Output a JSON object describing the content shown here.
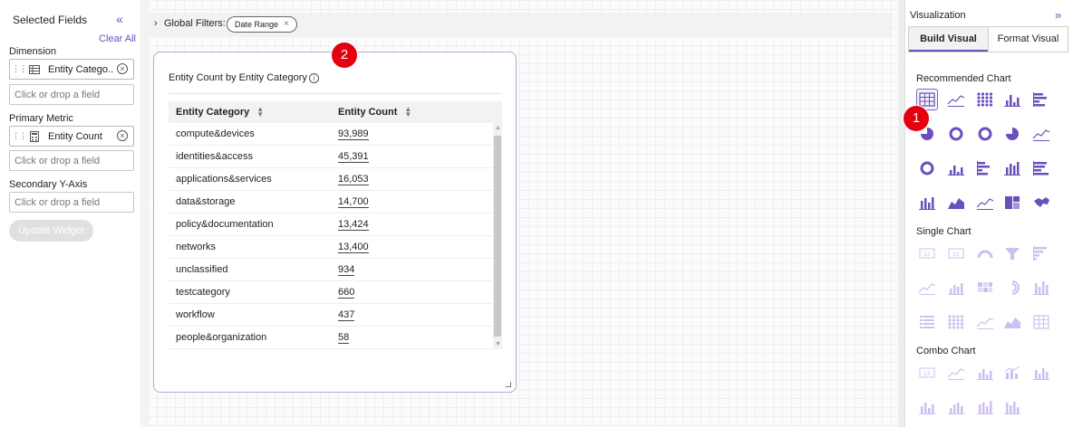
{
  "left_panel": {
    "title": "Selected Fields",
    "clear_all": "Clear All",
    "dimension_label": "Dimension",
    "dimension_field": "Entity Catego...",
    "primary_metric_label": "Primary Metric",
    "primary_metric_field": "Entity Count",
    "drop_placeholder": "Click or drop a field",
    "secondary_label": "Secondary Y-Axis",
    "update_button": "Update Widget"
  },
  "global_filters": {
    "label": "Global Filters:",
    "chip": "Date Range"
  },
  "widget": {
    "title": "Entity Count by Entity Category",
    "columns": [
      "Entity Category",
      "Entity Count"
    ],
    "rows": [
      [
        "compute&devices",
        "93,989"
      ],
      [
        "identities&access",
        "45,391"
      ],
      [
        "applications&services",
        "16,053"
      ],
      [
        "data&storage",
        "14,700"
      ],
      [
        "policy&documentation",
        "13,424"
      ],
      [
        "networks",
        "13,400"
      ],
      [
        "unclassified",
        "934"
      ],
      [
        "testcategory",
        "660"
      ],
      [
        "workflow",
        "437"
      ],
      [
        "people&organization",
        "58"
      ]
    ]
  },
  "badges": {
    "one": "1",
    "two": "2"
  },
  "visualization": {
    "title": "Visualization",
    "tabs": [
      "Build Visual",
      "Format Visual"
    ],
    "recommended": "Recommended Chart",
    "single": "Single Chart",
    "combo": "Combo Chart"
  },
  "colors": {
    "accent": "#6b4fbb",
    "badge": "#e3000f",
    "icon_light": "#cdbff0"
  }
}
